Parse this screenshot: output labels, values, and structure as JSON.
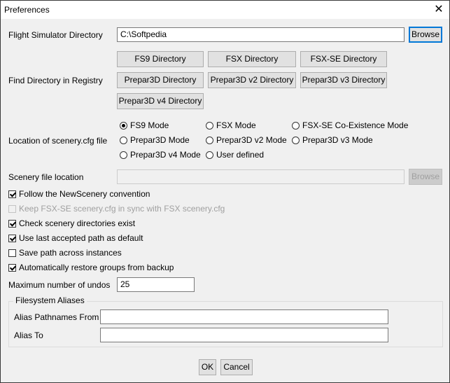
{
  "window": {
    "title": "Preferences",
    "close_glyph": "✕"
  },
  "flight_sim": {
    "label": "Flight Simulator Directory",
    "value": "C:\\Softpedia",
    "browse_label": "Browse"
  },
  "registry": {
    "label": "Find Directory in Registry",
    "buttons": [
      "FS9 Directory",
      "FSX Directory",
      "FSX-SE Directory",
      "Prepar3D Directory",
      "Prepar3D v2 Directory",
      "Prepar3D v3 Directory",
      "Prepar3D v4 Directory"
    ]
  },
  "scenery_cfg": {
    "label": "Location of scenery.cfg file",
    "options": [
      "FS9 Mode",
      "FSX Mode",
      "FSX-SE Co-Existence Mode",
      "Prepar3D Mode",
      "Prepar3D v2 Mode",
      "Prepar3D v3 Mode",
      "Prepar3D v4 Mode",
      "User defined"
    ],
    "selected": "FS9 Mode"
  },
  "scenery_file": {
    "label": "Scenery file location",
    "value": "",
    "browse_label": "Browse"
  },
  "checkboxes": [
    {
      "label": "Follow the NewScenery convention",
      "checked": true,
      "enabled": true
    },
    {
      "label": "Keep FSX-SE scenery.cfg in sync with FSX scenery.cfg",
      "checked": false,
      "enabled": false
    },
    {
      "label": "Check scenery directories exist",
      "checked": true,
      "enabled": true
    },
    {
      "label": "Use last accepted path as default",
      "checked": true,
      "enabled": true
    },
    {
      "label": "Save path across instances",
      "checked": false,
      "enabled": true
    },
    {
      "label": "Automatically restore groups from backup",
      "checked": true,
      "enabled": true
    }
  ],
  "undos": {
    "label": "Maximum number of undos",
    "value": "25"
  },
  "aliases": {
    "group_title": "Filesystem Aliases",
    "from_label": "Alias Pathnames From",
    "from_value": "",
    "to_label": "Alias To",
    "to_value": ""
  },
  "footer": {
    "ok_label": "OK",
    "cancel_label": "Cancel"
  },
  "colors": {
    "accent": "#0078d7",
    "background": "#f0f0f0"
  }
}
